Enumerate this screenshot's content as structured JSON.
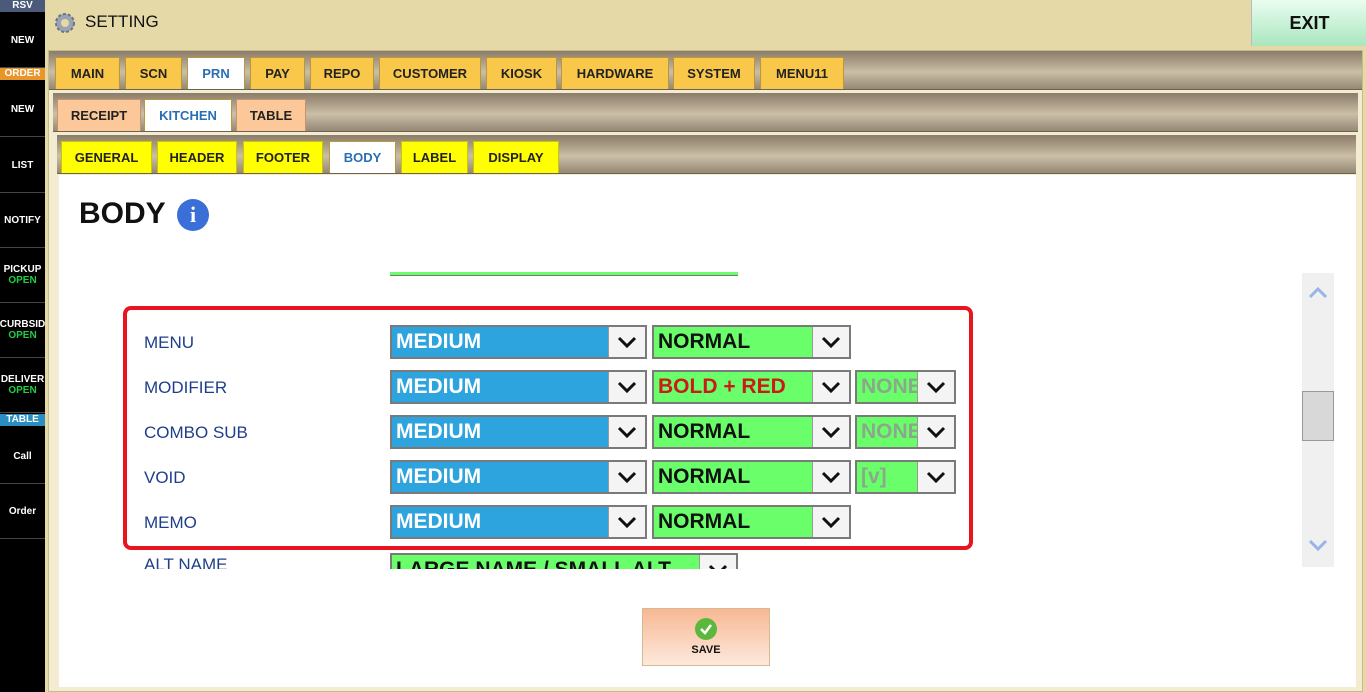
{
  "sidebar": {
    "rsv_label": "RSV",
    "order_label": "ORDER",
    "table_label": "TABLE",
    "items": [
      {
        "label": "NEW",
        "sub": ""
      },
      {
        "label": "NEW",
        "sub": ""
      },
      {
        "label": "LIST",
        "sub": ""
      },
      {
        "label": "NOTIFY",
        "sub": ""
      },
      {
        "label": "PICKUP",
        "sub": "OPEN"
      },
      {
        "label": "CURBSID",
        "sub": "OPEN"
      },
      {
        "label": "DELIVER",
        "sub": "OPEN"
      },
      {
        "label": "Call",
        "sub": ""
      },
      {
        "label": "Order",
        "sub": ""
      }
    ]
  },
  "header": {
    "title": "SETTING",
    "exit_label": "EXIT"
  },
  "tabs_main": [
    "MAIN",
    "SCN",
    "PRN",
    "PAY",
    "REPO",
    "CUSTOMER",
    "KIOSK",
    "HARDWARE",
    "SYSTEM",
    "MENU11"
  ],
  "tabs_main_active": "PRN",
  "tabs_prn": [
    "RECEIPT",
    "KITCHEN",
    "TABLE"
  ],
  "tabs_prn_active": "KITCHEN",
  "tabs_kitchen": [
    "GENERAL",
    "HEADER",
    "FOOTER",
    "BODY",
    "LABEL",
    "DISPLAY"
  ],
  "tabs_kitchen_active": "BODY",
  "body": {
    "title": "BODY",
    "info_icon": "i",
    "rows": [
      {
        "label": "MENU",
        "size": "MEDIUM",
        "style": "NORMAL",
        "extra": ""
      },
      {
        "label": "MODIFIER",
        "size": "MEDIUM",
        "style": "BOLD + RED",
        "extra": "NONE"
      },
      {
        "label": "COMBO SUB",
        "size": "MEDIUM",
        "style": "NORMAL",
        "extra": "NONE"
      },
      {
        "label": "VOID",
        "size": "MEDIUM",
        "style": "NORMAL",
        "extra": "[v]"
      },
      {
        "label": "MEMO",
        "size": "MEDIUM",
        "style": "NORMAL",
        "extra": ""
      }
    ],
    "partial_row": {
      "label": "ALT NAME",
      "value": "LARGE NAME / SMALL ALT"
    }
  },
  "save_label": "SAVE"
}
